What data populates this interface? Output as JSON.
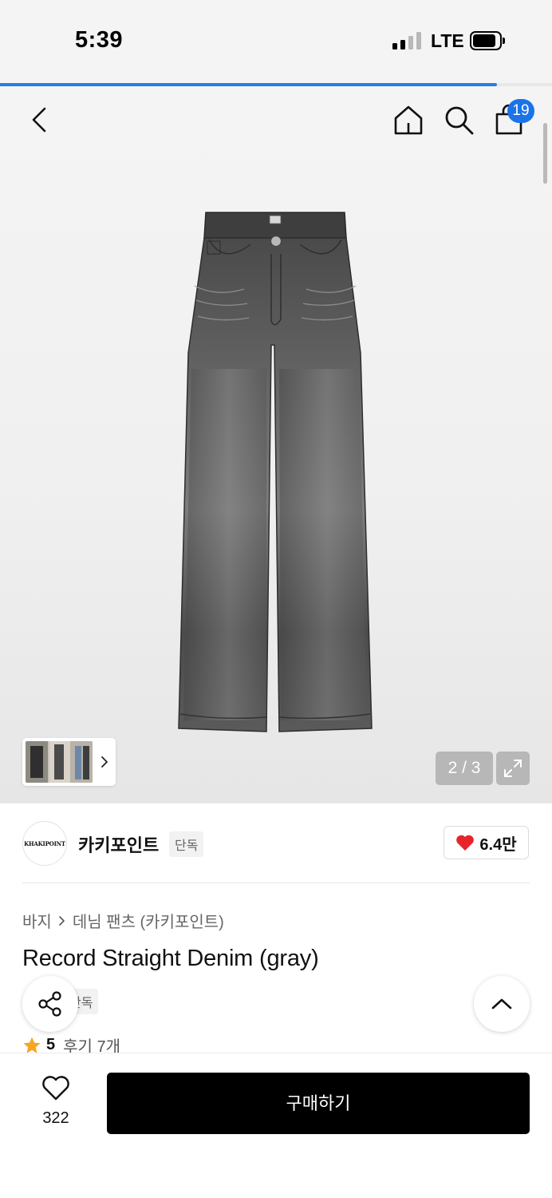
{
  "status_bar": {
    "time": "5:39",
    "network": "LTE",
    "signal_icon": "signal-bars-icon",
    "battery_icon": "battery-icon"
  },
  "page_load_progress": 0.9,
  "header": {
    "back_icon": "chevron-left-icon",
    "home_icon": "home-icon",
    "search_icon": "search-icon",
    "cart_icon": "shopping-bag-icon",
    "cart_count": "19"
  },
  "gallery": {
    "pager_text": "2 / 3",
    "expand_icon": "expand-icon",
    "thumbnail_chevron_icon": "chevron-right-icon"
  },
  "brand": {
    "logo_text": "KHAKIPOINT",
    "name": "카키포인트",
    "tag": "단독",
    "like_icon": "heart-icon",
    "like_color": "#e8242b",
    "like_count": "6.4만"
  },
  "breadcrumb": {
    "category": "바지",
    "subcategory": "데님 팬츠 (카키포인트)"
  },
  "product": {
    "title": "Record Straight Denim (gray)",
    "tag": "단독",
    "rating": "5",
    "review_link": "후기 7개",
    "star_color": "#f5a623"
  },
  "floating": {
    "share_icon": "share-icon",
    "scroll_top_icon": "chevron-up-icon"
  },
  "bottom_bar": {
    "wish_icon": "heart-outline-icon",
    "wish_count": "322",
    "buy_label": "구매하기"
  }
}
